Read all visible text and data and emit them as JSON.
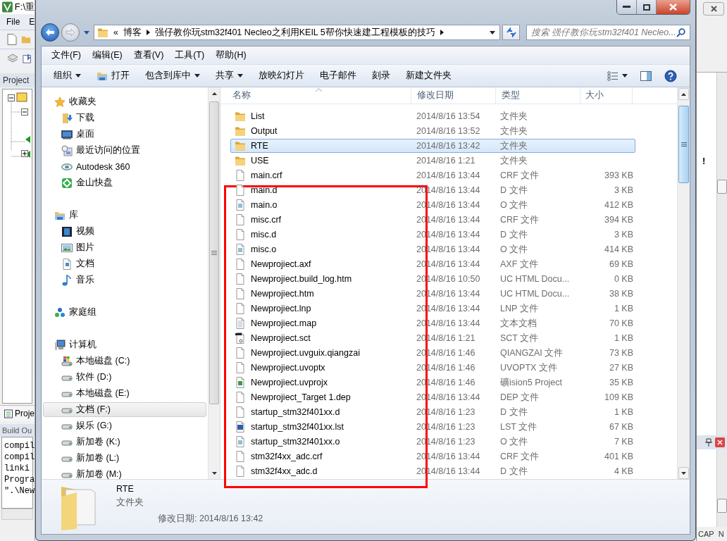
{
  "background_app": {
    "title": "F:\\重",
    "menu": [
      "File",
      "E"
    ],
    "project_panel": {
      "title": "Project"
    },
    "project_tab": "Proje",
    "build_output": {
      "title": "Build Ou",
      "lines": [
        "compil",
        "compil",
        "linki",
        "Progra",
        "\".\\New"
      ]
    },
    "side_mark": "!",
    "status": [
      "CAP",
      "N"
    ]
  },
  "explorer": {
    "address": {
      "overflow": "«",
      "crumbs": [
        "博客",
        "强仔教你玩stm32f401 Necleo之利用KEIL 5帮你快速建工程模板的技巧"
      ]
    },
    "search": {
      "placeholder": "搜索 强仔教你玩stm32f401 Necleo..."
    },
    "menu": [
      "文件(F)",
      "编辑(E)",
      "查看(V)",
      "工具(T)",
      "帮助(H)"
    ],
    "commands": [
      {
        "label": "组织",
        "kind": "menu"
      },
      {
        "label": "打开",
        "kind": "open"
      },
      {
        "label": "包含到库中",
        "kind": "menu"
      },
      {
        "label": "共享",
        "kind": "menu"
      },
      {
        "label": "放映幻灯片",
        "kind": "plain"
      },
      {
        "label": "电子邮件",
        "kind": "plain"
      },
      {
        "label": "刻录",
        "kind": "plain"
      },
      {
        "label": "新建文件夹",
        "kind": "plain"
      }
    ],
    "nav": [
      {
        "label": "收藏夹",
        "kind": "star",
        "selected": false,
        "children": [
          {
            "label": "下载",
            "kind": "download",
            "selected": false
          },
          {
            "label": "桌面",
            "kind": "desktop",
            "selected": false
          },
          {
            "label": "最近访问的位置",
            "kind": "recent",
            "selected": false
          },
          {
            "label": "Autodesk 360",
            "kind": "swirl",
            "selected": false
          },
          {
            "label": "金山快盘",
            "kind": "diamond",
            "selected": false
          }
        ]
      },
      {
        "label": "库",
        "kind": "library",
        "selected": false,
        "children": [
          {
            "label": "视频",
            "kind": "video",
            "selected": false
          },
          {
            "label": "图片",
            "kind": "pictures",
            "selected": false
          },
          {
            "label": "文档",
            "kind": "documents",
            "selected": false
          },
          {
            "label": "音乐",
            "kind": "music",
            "selected": false
          }
        ]
      },
      {
        "label": "家庭组",
        "kind": "homegroup",
        "selected": false
      },
      {
        "label": "计算机",
        "kind": "computer",
        "selected": false,
        "children": [
          {
            "label": "本地磁盘 (C:)",
            "kind": "systemdrive",
            "selected": false
          },
          {
            "label": "软件 (D:)",
            "kind": "drive",
            "selected": false
          },
          {
            "label": "本地磁盘 (E:)",
            "kind": "drive",
            "selected": false
          },
          {
            "label": "文档 (F:)",
            "kind": "drive",
            "selected": true
          },
          {
            "label": "娱乐 (G:)",
            "kind": "drive",
            "selected": false
          },
          {
            "label": "新加卷 (K:)",
            "kind": "drive",
            "selected": false
          },
          {
            "label": "新加卷 (L:)",
            "kind": "drive",
            "selected": false
          },
          {
            "label": "新加卷 (M:)",
            "kind": "drive",
            "selected": false
          }
        ]
      }
    ],
    "columns": [
      {
        "label": "名称",
        "sorted": true
      },
      {
        "label": "修改日期",
        "sorted": false
      },
      {
        "label": "类型",
        "sorted": false
      },
      {
        "label": "大小",
        "sorted": false
      }
    ],
    "files": [
      {
        "name": "List",
        "date": "2014/8/16 13:54",
        "type": "文件夹",
        "kind": "folder",
        "selected": false
      },
      {
        "name": "Output",
        "date": "2014/8/16 13:52",
        "type": "文件夹",
        "kind": "folder",
        "selected": false
      },
      {
        "name": "RTE",
        "date": "2014/8/16 13:42",
        "type": "文件夹",
        "kind": "folder",
        "selected": true
      },
      {
        "name": "USE",
        "date": "2014/8/16 1:21",
        "type": "文件夹",
        "kind": "folder",
        "selected": false
      },
      {
        "name": "main.crf",
        "date": "2014/8/16 13:44",
        "type": "CRF 文件",
        "size": "393 KB",
        "kind": "file",
        "selected": false
      },
      {
        "name": "main.d",
        "date": "2014/8/16 13:44",
        "type": "D 文件",
        "size": "3 KB",
        "kind": "file",
        "selected": false
      },
      {
        "name": "main.o",
        "date": "2014/8/16 13:44",
        "type": "O 文件",
        "size": "412 KB",
        "kind": "object",
        "selected": false
      },
      {
        "name": "misc.crf",
        "date": "2014/8/16 13:44",
        "type": "CRF 文件",
        "size": "394 KB",
        "kind": "file",
        "selected": false
      },
      {
        "name": "misc.d",
        "date": "2014/8/16 13:44",
        "type": "D 文件",
        "size": "3 KB",
        "kind": "file",
        "selected": false
      },
      {
        "name": "misc.o",
        "date": "2014/8/16 13:44",
        "type": "O 文件",
        "size": "414 KB",
        "kind": "object",
        "selected": false
      },
      {
        "name": "Newprojiect.axf",
        "date": "2014/8/16 13:44",
        "type": "AXF 文件",
        "size": "69 KB",
        "kind": "file",
        "selected": false
      },
      {
        "name": "Newprojiect.build_log.htm",
        "date": "2014/8/16 10:50",
        "type": "UC HTML Docu...",
        "size": "0 KB",
        "kind": "file",
        "selected": false
      },
      {
        "name": "Newprojiect.htm",
        "date": "2014/8/16 13:44",
        "type": "UC HTML Docu...",
        "size": "38 KB",
        "kind": "file",
        "selected": false
      },
      {
        "name": "Newprojiect.lnp",
        "date": "2014/8/16 13:44",
        "type": "LNP 文件",
        "size": "1 KB",
        "kind": "file",
        "selected": false
      },
      {
        "name": "Newprojiect.map",
        "date": "2014/8/16 13:44",
        "type": "文本文档",
        "size": "70 KB",
        "kind": "text",
        "selected": false
      },
      {
        "name": "Newprojiect.sct",
        "date": "2014/8/16 1:21",
        "type": "SCT 文件",
        "size": "1 KB",
        "kind": "script",
        "selected": false
      },
      {
        "name": "Newprojiect.uvguix.qiangzai",
        "date": "2014/8/16 1:46",
        "type": "QIANGZAI 文件",
        "size": "73 KB",
        "kind": "file",
        "selected": false
      },
      {
        "name": "Newprojiect.uvoptx",
        "date": "2014/8/16 1:46",
        "type": "UVOPTX 文件",
        "size": "27 KB",
        "kind": "file",
        "selected": false
      },
      {
        "name": "Newprojiect.uvprojx",
        "date": "2014/8/16 1:46",
        "type": "礦ision5 Project",
        "size": "35 KB",
        "kind": "project",
        "selected": false
      },
      {
        "name": "Newprojiect_Target 1.dep",
        "date": "2014/8/16 13:44",
        "type": "DEP 文件",
        "size": "109 KB",
        "kind": "file",
        "selected": false
      },
      {
        "name": "startup_stm32f401xx.d",
        "date": "2014/8/16 1:23",
        "type": "D 文件",
        "size": "1 KB",
        "kind": "file",
        "selected": false
      },
      {
        "name": "startup_stm32f401xx.lst",
        "date": "2014/8/16 1:23",
        "type": "LST 文件",
        "size": "67 KB",
        "kind": "listing",
        "selected": false
      },
      {
        "name": "startup_stm32f401xx.o",
        "date": "2014/8/16 1:23",
        "type": "O 文件",
        "size": "7 KB",
        "kind": "object",
        "selected": false
      },
      {
        "name": "stm32f4xx_adc.crf",
        "date": "2014/8/16 13:44",
        "type": "CRF 文件",
        "size": "401 KB",
        "kind": "file",
        "selected": false
      },
      {
        "name": "stm32f4xx_adc.d",
        "date": "2014/8/16 13:44",
        "type": "D 文件",
        "size": "4 KB",
        "kind": "file",
        "selected": false
      }
    ],
    "details": {
      "name": "RTE",
      "type": "文件夹",
      "modified": "修改日期: 2014/8/16 13:42"
    }
  }
}
